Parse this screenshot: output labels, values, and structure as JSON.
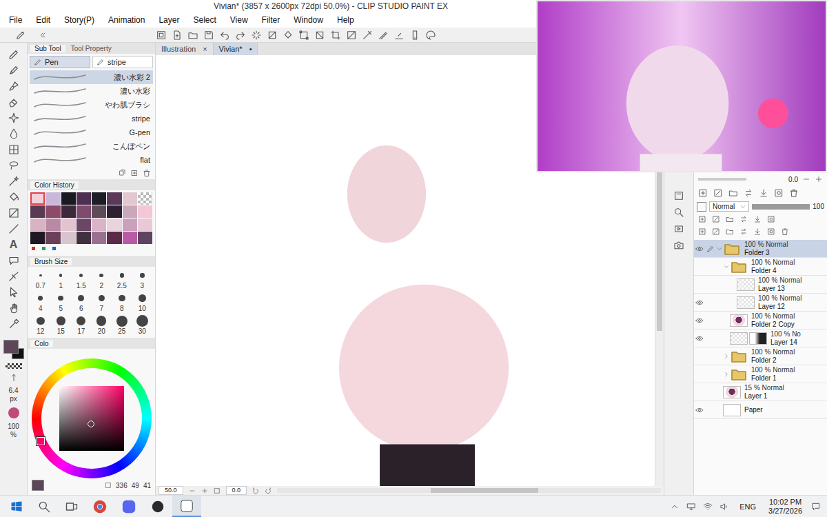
{
  "window": {
    "title": "Vivian* (3857 x 2600px 72dpi 50.0%) - CLIP STUDIO PAINT EX"
  },
  "menu": [
    "File",
    "Edit",
    "Story(P)",
    "Animation",
    "Layer",
    "Select",
    "View",
    "Filter",
    "Window",
    "Help"
  ],
  "toolbar": {
    "text_tool_glyph": "A",
    "main_color": "#5d4657",
    "sub_color": "#111111",
    "size": "6.4",
    "size_unit": "px",
    "opacity": "100",
    "opacity_unit": "%"
  },
  "sub_tool": {
    "tabs": [
      {
        "label": "Sub Tool",
        "selected": true
      },
      {
        "label": "Tool Property",
        "selected": false
      }
    ],
    "groups": [
      {
        "label": "Pen",
        "selected": true
      },
      {
        "label": "stripe",
        "selected": false
      }
    ],
    "brushes": [
      {
        "label": "濃い水彩 2",
        "selected": true
      },
      {
        "label": "濃い水彩",
        "selected": false
      },
      {
        "label": "やわ肌ブラシ",
        "selected": false
      },
      {
        "label": "stripe",
        "selected": false
      },
      {
        "label": "G-pen",
        "selected": false
      },
      {
        "label": "こんぼペン",
        "selected": false
      },
      {
        "label": "flat",
        "selected": false
      }
    ]
  },
  "color_history": {
    "title": "Color History",
    "swatches": [
      {
        "color": "#f3d3da",
        "selected": true,
        "transparent": false
      },
      {
        "color": "#c9b8dc",
        "selected": false,
        "transparent": false
      },
      {
        "color": "#1a1a22",
        "selected": false,
        "transparent": false
      },
      {
        "color": "#4e2f4f",
        "selected": false,
        "transparent": false
      },
      {
        "color": "#1e1e28",
        "selected": false,
        "transparent": false
      },
      {
        "color": "#5b3a59",
        "selected": false,
        "transparent": false
      },
      {
        "color": "#e4c8d0",
        "selected": false,
        "transparent": false
      },
      {
        "color": "#ffffff",
        "selected": false,
        "transparent": true
      },
      {
        "color": "#5a3a52",
        "selected": false,
        "transparent": false
      },
      {
        "color": "#8e4a66",
        "selected": false,
        "transparent": false
      },
      {
        "color": "#3c2a3c",
        "selected": false,
        "transparent": false
      },
      {
        "color": "#7e4a6e",
        "selected": false,
        "transparent": false
      },
      {
        "color": "#5e4a58",
        "selected": false,
        "transparent": false
      },
      {
        "color": "#2e2030",
        "selected": false,
        "transparent": false
      },
      {
        "color": "#c9a9b9",
        "selected": false,
        "transparent": false
      },
      {
        "color": "#f4c6d6",
        "selected": false,
        "transparent": false
      },
      {
        "color": "#d7b3c3",
        "selected": false,
        "transparent": false
      },
      {
        "color": "#b98aa6",
        "selected": false,
        "transparent": false
      },
      {
        "color": "#e2c3cf",
        "selected": false,
        "transparent": false
      },
      {
        "color": "#6b4666",
        "selected": false,
        "transparent": false
      },
      {
        "color": "#d9b4c9",
        "selected": false,
        "transparent": false
      },
      {
        "color": "#e9d3dd",
        "selected": false,
        "transparent": false
      },
      {
        "color": "#caa1bd",
        "selected": false,
        "transparent": false
      },
      {
        "color": "#eac9d7",
        "selected": false,
        "transparent": false
      },
      {
        "color": "#1e1822",
        "selected": false,
        "transparent": false
      },
      {
        "color": "#6b3e5a",
        "selected": false,
        "transparent": false
      },
      {
        "color": "#d8c4cc",
        "selected": false,
        "transparent": false
      },
      {
        "color": "#40303e",
        "selected": false,
        "transparent": false
      },
      {
        "color": "#9a7092",
        "selected": false,
        "transparent": false
      },
      {
        "color": "#5a2a48",
        "selected": false,
        "transparent": false
      },
      {
        "color": "#b95aa5",
        "selected": false,
        "transparent": false
      },
      {
        "color": "#5e4460",
        "selected": false,
        "transparent": false
      }
    ]
  },
  "brush_size": {
    "title": "Brush Size",
    "sizes": [
      "0.7",
      "1",
      "1.5",
      "2",
      "2.5",
      "3",
      "4",
      "5",
      "6",
      "7",
      "8",
      "10",
      "12",
      "15",
      "17",
      "20",
      "25",
      "30"
    ]
  },
  "color_wheel": {
    "title": "Colo",
    "readings": [
      "336",
      "49",
      "41"
    ]
  },
  "canvas_tabs": [
    {
      "label": "Illustration",
      "close": "×",
      "selected": false
    },
    {
      "label": "Vivian*",
      "close": "•",
      "selected": true
    }
  ],
  "canvas_status": {
    "zoom": "50.0",
    "angle": "0.0"
  },
  "layers": {
    "reading": "0.0",
    "blend": "Normal",
    "opacity": "100",
    "items": [
      {
        "mode": "100 % Normal",
        "name": "Folder 3",
        "kind": "folder",
        "depth": 0,
        "visible": true,
        "selected": true,
        "expanded": true,
        "has_content": false,
        "mask": false
      },
      {
        "mode": "100 % Normal",
        "name": "Folder 4",
        "kind": "folder",
        "depth": 1,
        "visible": false,
        "selected": false,
        "expanded": true,
        "has_content": false,
        "mask": false
      },
      {
        "mode": "100 % Normal",
        "name": "Layer 13",
        "kind": "raster",
        "depth": 2,
        "visible": false,
        "selected": false,
        "expanded": false,
        "has_content": false,
        "mask": false
      },
      {
        "mode": "100 % Normal",
        "name": "Layer 12",
        "kind": "raster",
        "depth": 2,
        "visible": true,
        "selected": false,
        "expanded": false,
        "has_content": false,
        "mask": false
      },
      {
        "mode": "100 % Normal",
        "name": "Folder 2 Copy",
        "kind": "raster",
        "depth": 1,
        "visible": true,
        "selected": false,
        "expanded": false,
        "has_content": true,
        "mask": false
      },
      {
        "mode": "100 % No",
        "name": "Layer 14",
        "kind": "raster",
        "depth": 1,
        "visible": true,
        "selected": false,
        "expanded": false,
        "has_content": false,
        "mask": true
      },
      {
        "mode": "100 % Normal",
        "name": "Folder 2",
        "kind": "folder",
        "depth": 1,
        "visible": false,
        "selected": false,
        "expanded": false,
        "has_content": false,
        "mask": false
      },
      {
        "mode": "100 % Normal",
        "name": "Folder 1",
        "kind": "folder",
        "depth": 1,
        "visible": false,
        "selected": false,
        "expanded": false,
        "has_content": false,
        "mask": false
      },
      {
        "mode": "15 % Normal",
        "name": "Layer 1",
        "kind": "raster",
        "depth": 0,
        "visible": false,
        "selected": false,
        "expanded": false,
        "has_content": true,
        "mask": false
      },
      {
        "name": "Paper",
        "kind": "paper",
        "depth": 0,
        "visible": true,
        "selected": false,
        "expanded": false,
        "has_content": false,
        "mask": false
      }
    ]
  },
  "taskbar": {
    "apps": [
      {
        "name": "chrome",
        "active": false
      },
      {
        "name": "discord",
        "active": false
      },
      {
        "name": "app",
        "active": false
      },
      {
        "name": "clip-studio",
        "active": true
      }
    ],
    "tray": {
      "language": "ENG",
      "time": "10:02 PM",
      "date": "3/27/2026"
    }
  }
}
